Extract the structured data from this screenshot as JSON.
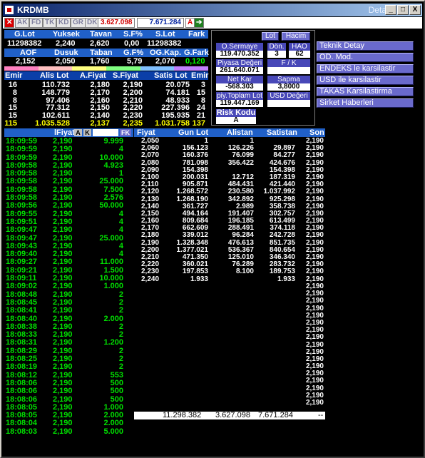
{
  "window": {
    "title": "KRDMB",
    "detay": "Detay",
    "min": "_",
    "max": "□",
    "close": "X"
  },
  "toolbar": {
    "tabs": [
      "AK",
      "FD",
      "TK",
      "KD",
      "GR",
      "DK"
    ],
    "val1": "3.627.098",
    "val2": "7.671.284",
    "a": "A"
  },
  "summary": {
    "headers1": [
      "G.Lot",
      "Yuksek",
      "Tavan",
      "S.F%",
      "S.Lot",
      "Fark"
    ],
    "values1": [
      "11298382",
      "2,240",
      "2,620",
      "0,00",
      "11298382",
      ""
    ],
    "headers2": [
      "AOF",
      "Dusuk",
      "Taban",
      "G.F%",
      "OG.Kap.",
      "G.Fark"
    ],
    "values2": [
      "2,152",
      "2,050",
      "1,760",
      "5,79",
      "2,070",
      "0,120"
    ]
  },
  "depth": {
    "headers": [
      "Emir",
      "Alis Lot",
      "A.Fiyat",
      "S.Fiyat",
      "Satis Lot",
      "Emir"
    ],
    "rows": [
      [
        "16",
        "110.732",
        "2,180",
        "2,190",
        "20.075",
        "3"
      ],
      [
        "8",
        "148.779",
        "2,170",
        "2,200",
        "74.181",
        "15"
      ],
      [
        "8",
        "97.406",
        "2,160",
        "2,210",
        "48.933",
        "8"
      ],
      [
        "15",
        "77.312",
        "2,150",
        "2,220",
        "227.396",
        "24"
      ],
      [
        "15",
        "102.611",
        "2,140",
        "2,230",
        "195.935",
        "21"
      ],
      [
        "115",
        "1.035.528",
        "2,137",
        "2,235",
        "1.031.758",
        "137"
      ]
    ]
  },
  "panel": {
    "lot": "Lot",
    "hacim": "Hacim",
    "osermaye_label": "O.Sermaye",
    "osermaye": "119.470.352",
    "don_label": "Dön.",
    "don": "3",
    "hao_label": "HAO",
    "hao": "62",
    "piyasa_label": "Piyasa Değeri",
    "piyasa": "261.640.071",
    "fk_label": "F / K",
    "fk": "",
    "netkar_label": "Net Kar",
    "netkar": "-568.303",
    "sapma_label": "Sapma",
    "sapma": "3,8000",
    "toplam_label": "piy.Toplam Lot",
    "toplam": "119.447.169",
    "usd_label": "USD Değeri",
    "usd": "",
    "risk_label": "Risk Kodu",
    "risk": "A"
  },
  "menu": [
    "Teknik Detay",
    "OD. Mod.",
    "ENDEKS le karsilastir",
    "USD ile karsilastir",
    "TAKAS Karsilastirma",
    "Sirket Haberleri"
  ],
  "trades": {
    "headers": [
      "Saat",
      "lFiyat",
      "A",
      "K",
      "",
      "FK"
    ],
    "rows": [
      [
        "18:09:59",
        "2,190",
        "9.999"
      ],
      [
        "18:09:59",
        "2,190",
        "4"
      ],
      [
        "18:09:59",
        "2,190",
        "10.000"
      ],
      [
        "18:09:58",
        "2,190",
        "4.923"
      ],
      [
        "18:09:58",
        "2,190",
        "1"
      ],
      [
        "18:09:58",
        "2,190",
        "25.000"
      ],
      [
        "18:09:58",
        "2,190",
        "7.500"
      ],
      [
        "18:09:58",
        "2,190",
        "2.576"
      ],
      [
        "18:09:56",
        "2,190",
        "50.000"
      ],
      [
        "18:09:55",
        "2,190",
        "4"
      ],
      [
        "18:09:51",
        "2,190",
        "4"
      ],
      [
        "18:09:47",
        "2,190",
        "4"
      ],
      [
        "18:09:47",
        "2,190",
        "25.000"
      ],
      [
        "18:09:43",
        "2,190",
        "4"
      ],
      [
        "18:09:40",
        "2,190",
        "4"
      ],
      [
        "18:09:27",
        "2,190",
        "11.000"
      ],
      [
        "18:09:21",
        "2,190",
        "1.500"
      ],
      [
        "18:09:11",
        "2,190",
        "10.000"
      ],
      [
        "18:09:02",
        "2,190",
        "1.000"
      ],
      [
        "18:08:48",
        "2,190",
        "2"
      ],
      [
        "18:08:45",
        "2,190",
        "2"
      ],
      [
        "18:08:41",
        "2,190",
        "2"
      ],
      [
        "18:08:40",
        "2,190",
        "2.000"
      ],
      [
        "18:08:38",
        "2,190",
        "2"
      ],
      [
        "18:08:33",
        "2,190",
        "2"
      ],
      [
        "18:08:31",
        "2,190",
        "1.200"
      ],
      [
        "18:08:29",
        "2,190",
        "2"
      ],
      [
        "18:08:25",
        "2,190",
        "2"
      ],
      [
        "18:08:19",
        "2,190",
        "2"
      ],
      [
        "18:08:12",
        "2,190",
        "553"
      ],
      [
        "18:08:06",
        "2,190",
        "500"
      ],
      [
        "18:08:06",
        "2,190",
        "500"
      ],
      [
        "18:08:06",
        "2,190",
        "500"
      ],
      [
        "18:08:05",
        "2,190",
        "1.000"
      ],
      [
        "18:08:05",
        "2,190",
        "2.000"
      ],
      [
        "18:08:04",
        "2,190",
        "2.000"
      ],
      [
        "18:08:03",
        "2,190",
        "5.000"
      ]
    ]
  },
  "prices": {
    "headers": [
      "Fiyat",
      "Gun Lot",
      "Alistan",
      "Satistan",
      "Son"
    ],
    "rows": [
      [
        "2,050",
        "1",
        "1",
        "",
        "2,190"
      ],
      [
        "2,060",
        "156.123",
        "126.226",
        "29.897",
        "2,190"
      ],
      [
        "2,070",
        "160.376",
        "76.099",
        "84.277",
        "2,190"
      ],
      [
        "2,080",
        "781.098",
        "356.422",
        "424.676",
        "2,190"
      ],
      [
        "2,090",
        "154.398",
        "",
        "154.398",
        "2,190"
      ],
      [
        "2,100",
        "200.031",
        "12.712",
        "187.319",
        "2,190"
      ],
      [
        "2,110",
        "905.871",
        "484.431",
        "421.440",
        "2,190"
      ],
      [
        "2,120",
        "1.268.572",
        "230.580",
        "1.037.992",
        "2,190"
      ],
      [
        "2,130",
        "1.268.190",
        "342.892",
        "925.298",
        "2,190"
      ],
      [
        "2,140",
        "361.727",
        "2.989",
        "358.738",
        "2,190"
      ],
      [
        "2,150",
        "494.164",
        "191.407",
        "302.757",
        "2,190"
      ],
      [
        "2,160",
        "809.684",
        "196.185",
        "613.499",
        "2,190"
      ],
      [
        "2,170",
        "662.609",
        "288.491",
        "374.118",
        "2,190"
      ],
      [
        "2,180",
        "339.012",
        "96.284",
        "242.728",
        "2,190"
      ],
      [
        "2,190",
        "1.328.348",
        "476.613",
        "851.735",
        "2,190"
      ],
      [
        "2,200",
        "1.377.021",
        "536.367",
        "840.654",
        "2,190"
      ],
      [
        "2,210",
        "471.350",
        "125.010",
        "346.340",
        "2,190"
      ],
      [
        "2,220",
        "360.021",
        "76.289",
        "283.732",
        "2,190"
      ],
      [
        "2,230",
        "197.853",
        "8.100",
        "189.753",
        "2,190"
      ],
      [
        "2,240",
        "1.933",
        "",
        "1.933",
        "2,190"
      ]
    ],
    "son_tail": [
      "2,190",
      "2,190",
      "2,190",
      "2,190",
      "2,190",
      "2,190",
      "2,190",
      "2,190",
      "2,190",
      "2,190",
      "2,190",
      "2,190",
      "2,190",
      "2,190",
      "2,190",
      "2,190",
      "2,190"
    ],
    "total": [
      "11.298.382",
      "3.627.098",
      "7.671.284",
      "--"
    ]
  }
}
